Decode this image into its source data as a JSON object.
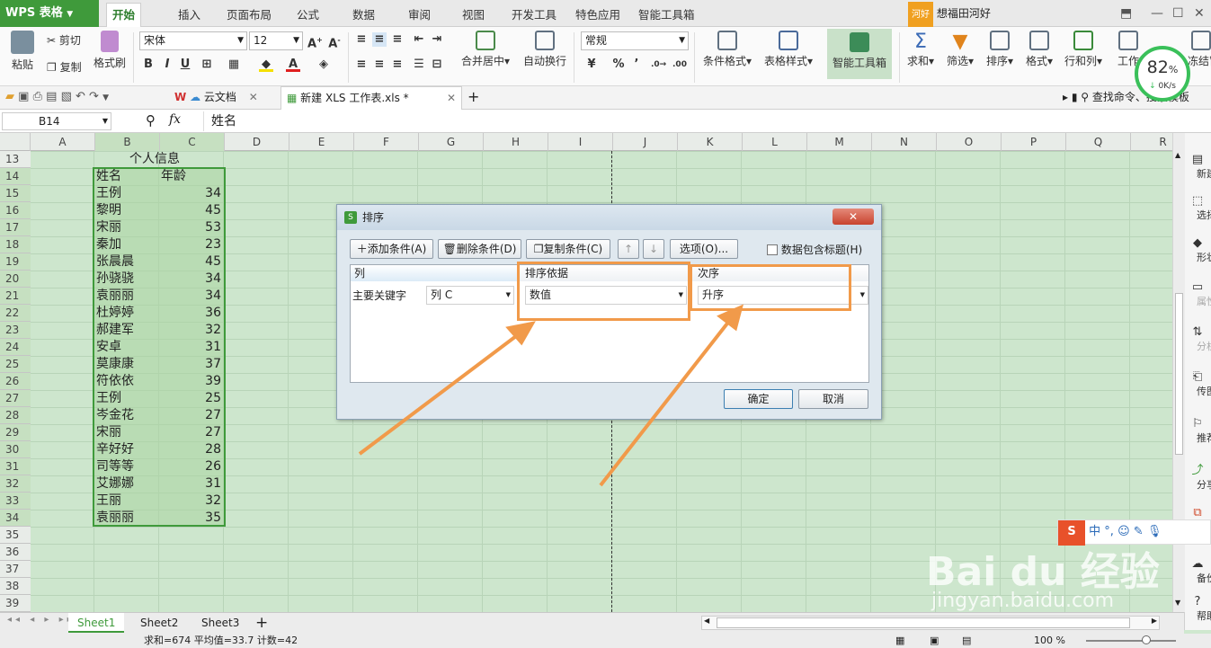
{
  "app": {
    "name": "WPS 表格",
    "menu_tabs": [
      "开始",
      "插入",
      "页面布局",
      "公式",
      "数据",
      "审阅",
      "视图",
      "开发工具",
      "特色应用",
      "智能工具箱"
    ],
    "user_badge": "河好",
    "user_name": "想福田河好"
  },
  "ribbon": {
    "paste": "粘贴",
    "cut": "剪切",
    "copy": "复制",
    "format_painter": "格式刷",
    "font_name": "宋体",
    "font_size": "12",
    "merge_center": "合并居中",
    "wrap_text": "自动换行",
    "number_format": "常规",
    "cond_format": "条件格式",
    "table_style": "表格样式",
    "smart_toolbox": "智能工具箱",
    "sum": "求和",
    "filter": "筛选",
    "sort": "排序",
    "format": "格式",
    "row_col": "行和列",
    "worksheet": "工作",
    "freeze": "冻结窗格",
    "percent_symbol": "%",
    "thousands_symbol": "’",
    "speed_percent": "82",
    "speed_unit": "%",
    "speed_rate": "0K/s"
  },
  "doc_tabs": {
    "cloud": "云文档",
    "file": "新建 XLS 工作表.xls *",
    "search": "查找命令、搜索模板"
  },
  "formula_bar": {
    "cell_ref": "B14",
    "fx": "fx",
    "content": "姓名"
  },
  "columns": [
    "A",
    "B",
    "C",
    "D",
    "E",
    "F",
    "G",
    "H",
    "I",
    "J",
    "K",
    "L",
    "M",
    "N",
    "O",
    "P",
    "Q",
    "R"
  ],
  "rows": [
    "13",
    "14",
    "15",
    "16",
    "17",
    "18",
    "19",
    "20",
    "21",
    "22",
    "23",
    "24",
    "25",
    "26",
    "27",
    "28",
    "29",
    "30",
    "31",
    "32",
    "33",
    "34",
    "35",
    "36",
    "37",
    "38",
    "39"
  ],
  "table": {
    "title": "个人信息",
    "header_name": "姓名",
    "header_age": "年龄",
    "records": [
      {
        "name": "王例",
        "age": "34"
      },
      {
        "name": "黎明",
        "age": "45"
      },
      {
        "name": "宋丽",
        "age": "53"
      },
      {
        "name": "秦加",
        "age": "23"
      },
      {
        "name": "张晨晨",
        "age": "45"
      },
      {
        "name": "孙骁骁",
        "age": "34"
      },
      {
        "name": "袁丽丽",
        "age": "34"
      },
      {
        "name": "杜婷婷",
        "age": "36"
      },
      {
        "name": "郝建军",
        "age": "32"
      },
      {
        "name": "安卓",
        "age": "31"
      },
      {
        "name": "莫康康",
        "age": "37"
      },
      {
        "name": "符依依",
        "age": "39"
      },
      {
        "name": "王例",
        "age": "25"
      },
      {
        "name": "岑金花",
        "age": "27"
      },
      {
        "name": "宋丽",
        "age": "27"
      },
      {
        "name": "辛好好",
        "age": "28"
      },
      {
        "name": "司等等",
        "age": "26"
      },
      {
        "name": "艾娜娜",
        "age": "31"
      },
      {
        "name": "王丽",
        "age": "32"
      },
      {
        "name": "袁丽丽",
        "age": "35"
      }
    ]
  },
  "dialog": {
    "title": "排序",
    "add_condition": "添加条件(A)",
    "delete_condition": "删除条件(D)",
    "copy_condition": "复制条件(C)",
    "options": "选项(O)...",
    "has_header": "数据包含标题(H)",
    "col_header": "列",
    "basis_header": "排序依据",
    "order_header": "次序",
    "primary_key": "主要关键字",
    "column_value": "列 C",
    "basis_value": "数值",
    "order_value": "升序",
    "ok": "确定",
    "cancel": "取消"
  },
  "sidebar": [
    "新建",
    "选择",
    "形状",
    "属性",
    "分析",
    "传图",
    "推荐",
    "分享",
    "工具",
    "备份",
    "帮助"
  ],
  "sheets": [
    "Sheet1",
    "Sheet2",
    "Sheet3"
  ],
  "status": {
    "summary": "求和=674  平均值=33.7  计数=42",
    "zoom": "100 %"
  },
  "watermark": {
    "brand": "Bai du 经验",
    "url": "jingyan.baidu.com"
  },
  "colors": {
    "accent": "#3f9a3b",
    "highlight": "#f19a4a",
    "sheet_bg": "#cde6cd"
  }
}
